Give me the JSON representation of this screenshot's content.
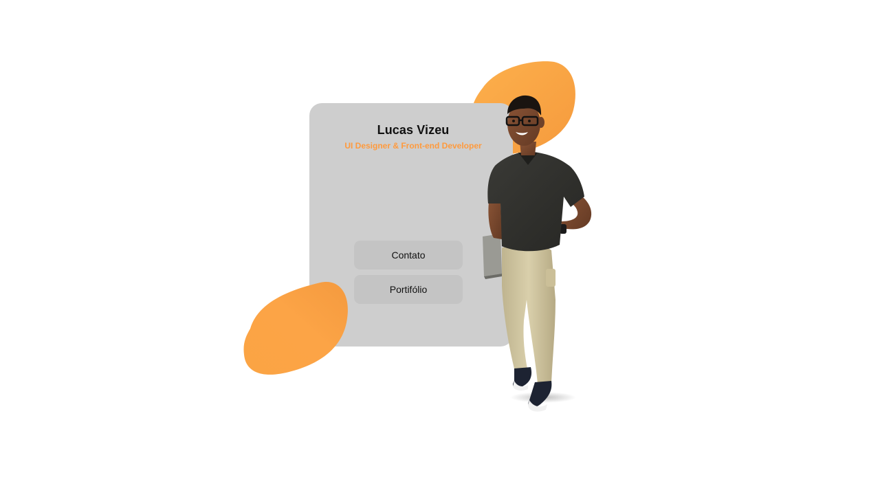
{
  "profile": {
    "name": "Lucas Vizeu",
    "role": "UI Designer & Front-end Developer"
  },
  "buttons": {
    "contact_label": "Contato",
    "portfolio_label": "Portifólio"
  },
  "colors": {
    "accent": "#ff9a3d",
    "blob": "#fba444",
    "card": "#cecece",
    "button": "#c4c4c4"
  },
  "illustration": {
    "icon": "person-3d-illustration"
  }
}
